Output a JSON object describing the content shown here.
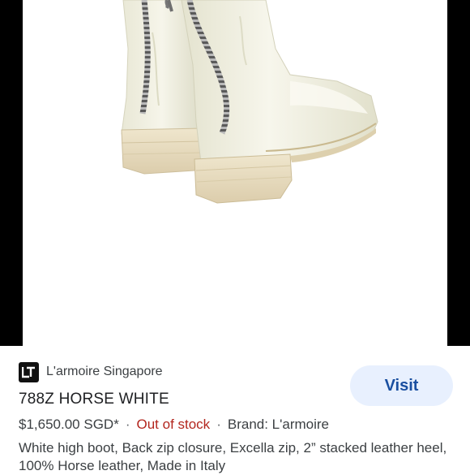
{
  "product_image": {
    "subject": "white-leather-back-zip-boots",
    "colors": {
      "leather": "#efeee0",
      "heel": "#e8dcc0",
      "zipper": "#8a8a8a"
    }
  },
  "merchant": {
    "logo_icon": "larmoire-logo-icon",
    "name": "L'armoire Singapore"
  },
  "visit_button": {
    "label": "Visit"
  },
  "product": {
    "title": "788Z HORSE WHITE",
    "price": "$1,650.00 SGD*",
    "separator": "·",
    "stock_status": "Out of stock",
    "brand": "Brand: L'armoire",
    "description": "White high boot, Back zip closure, Excella zip, 2” stacked leather heel, 100% Horse leather, Made in Italy"
  },
  "theme": {
    "visit_bg": "#e8f0fe",
    "visit_text": "#1a4fa0",
    "out_of_stock": "#b3261e"
  }
}
